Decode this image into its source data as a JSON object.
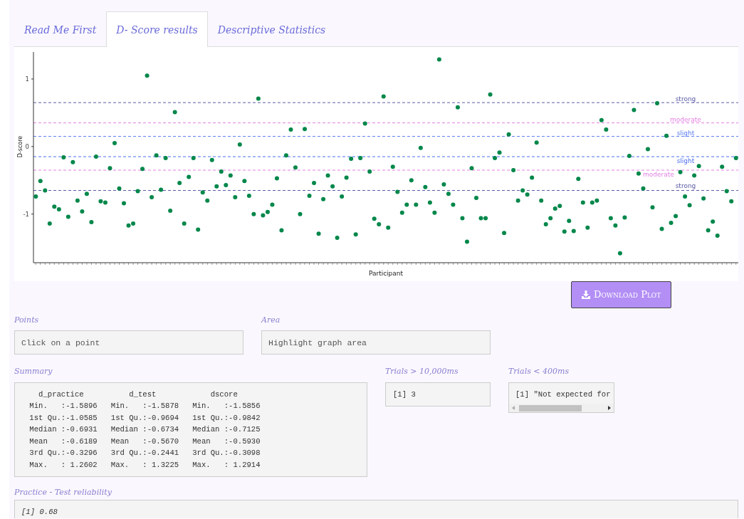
{
  "tabs": [
    {
      "label": "Read Me First",
      "selected": false
    },
    {
      "label": "D- Score results",
      "selected": true
    },
    {
      "label": "Descriptive Statistics",
      "selected": false
    }
  ],
  "plot": {
    "chart_data": {
      "type": "scatter",
      "xlabel": "Participant",
      "ylabel": "D-score",
      "ylim": [
        -1.72,
        1.4
      ],
      "yticks": [
        -1,
        0,
        1
      ],
      "categories": [
        null,
        null,
        null,
        null,
        null,
        null,
        null,
        null,
        null,
        null,
        null,
        null,
        null,
        null,
        null,
        null,
        null,
        null,
        null,
        null,
        null,
        null,
        null,
        null,
        null,
        null,
        null,
        null,
        null,
        null,
        null,
        null,
        null,
        null,
        null,
        null,
        null,
        null,
        null,
        null,
        null,
        null,
        null,
        null,
        null,
        null,
        null,
        null,
        null,
        null,
        null,
        null,
        null,
        null,
        null,
        null,
        null,
        null,
        null,
        null,
        null,
        null,
        null,
        null,
        null,
        null,
        null,
        null,
        null,
        null,
        null,
        null,
        null,
        null,
        null,
        null,
        null,
        null,
        null,
        null,
        null,
        null,
        null,
        null,
        null,
        null,
        null,
        null,
        null,
        null,
        null,
        null,
        null,
        null,
        null,
        null,
        null,
        null,
        null,
        null,
        null,
        null,
        null,
        null,
        null,
        null,
        null,
        null,
        null,
        null,
        null,
        null,
        null,
        null,
        null,
        null,
        null,
        null,
        null,
        null,
        null,
        null,
        null,
        null,
        null,
        null,
        null,
        null,
        null,
        null,
        null,
        null,
        null,
        null,
        null,
        null,
        null,
        null,
        null,
        null,
        null,
        null,
        null,
        null,
        null,
        null,
        null,
        null,
        null,
        null,
        null,
        null
      ],
      "series": [
        {
          "color": "#00874a",
          "values": [
            -0.74,
            -0.51,
            -0.65,
            -1.14,
            -0.89,
            -0.93,
            -0.16,
            -1.04,
            -0.23,
            -0.8,
            -0.96,
            -0.7,
            -1.12,
            -0.15,
            -0.81,
            -0.83,
            -0.32,
            0.05,
            -0.62,
            -0.84,
            -1.17,
            -1.14,
            -0.66,
            -0.33,
            1.05,
            -0.75,
            -0.13,
            -0.64,
            -0.17,
            -0.95,
            0.51,
            -0.54,
            -1.14,
            -0.45,
            -0.17,
            -1.23,
            -0.68,
            -0.8,
            -0.2,
            -0.59,
            -0.37,
            -0.57,
            -0.43,
            -0.75,
            0.03,
            -0.51,
            -0.73,
            -1.0,
            0.71,
            -1.02,
            -0.97,
            -0.86,
            -0.47,
            -1.24,
            -0.13,
            0.25,
            -0.31,
            -1.0,
            0.26,
            -0.73,
            -0.54,
            -1.29,
            -0.78,
            -0.43,
            -0.59,
            -1.35,
            -0.74,
            -0.46,
            -0.18,
            -1.3,
            -0.17,
            0.34,
            -0.37,
            -1.07,
            -1.15,
            0.74,
            -1.2,
            -0.3,
            -0.67,
            -0.98,
            -0.86,
            -0.5,
            -0.86,
            -0.02,
            -0.6,
            -0.83,
            -0.98,
            1.29,
            -0.56,
            -0.7,
            -0.86,
            0.58,
            -1.06,
            -1.41,
            -0.32,
            -0.76,
            -1.06,
            -1.06,
            0.77,
            -0.17,
            -0.09,
            -1.28,
            0.18,
            -0.35,
            -0.8,
            -0.65,
            -0.71,
            -0.46,
            0.06,
            -0.8,
            -1.15,
            -1.06,
            -0.92,
            -0.88,
            -1.26,
            -1.1,
            -1.25,
            -0.48,
            -0.83,
            -1.2,
            -0.83,
            -0.8,
            0.39,
            0.25,
            -1.06,
            -1.17,
            -1.58,
            -1.05,
            -0.14,
            0.54,
            -0.4,
            -0.62,
            -0.04,
            -0.9,
            0.64,
            -1.22,
            0.16,
            -1.13,
            -1.03,
            -0.38,
            -0.74,
            -0.87,
            -0.43,
            -0.29,
            -0.77,
            -1.24,
            -1.11,
            -1.32,
            -0.3,
            -0.66,
            -0.81,
            -0.17
          ]
        }
      ],
      "ref_lines": [
        {
          "axis": "y",
          "value": 0.65,
          "label": "strong",
          "color": "#5a5aa6"
        },
        {
          "axis": "y",
          "value": 0.35,
          "label": "moderate",
          "color": "#e27fe2"
        },
        {
          "axis": "y",
          "value": 0.15,
          "label": "slight",
          "color": "#5b7cf0"
        },
        {
          "axis": "y",
          "value": -0.15,
          "label": "slight",
          "color": "#4d6ff0"
        },
        {
          "axis": "y",
          "value": -0.35,
          "label": "moderate",
          "color": "#e27fe2"
        },
        {
          "axis": "y",
          "value": -0.65,
          "label": "strong",
          "color": "#5a5aa6"
        }
      ]
    }
  },
  "download_button": {
    "label": "Download Plot"
  },
  "points": {
    "label": "Points",
    "placeholder": "Click on a point"
  },
  "area": {
    "label": "Area",
    "placeholder": "Highlight graph area"
  },
  "summary": {
    "label": "Summary",
    "lines": [
      "   d_practice          d_test            dscore",
      " Min.   :-1.5896   Min.   :-1.5878   Min.   :-1.5856",
      " 1st Qu.:-1.0585   1st Qu.:-0.9694   1st Qu.:-0.9842",
      " Median :-0.6931   Median :-0.6734   Median :-0.7125",
      " Mean   :-0.6189   Mean   :-0.5670   Mean   :-0.5930",
      " 3rd Qu.:-0.3296   3rd Qu.:-0.2441   3rd Qu.:-0.3098",
      " Max.   : 1.2602   Max.   : 1.3225   Max.   : 1.2914"
    ]
  },
  "trials_over": {
    "label": "Trials > 10,000ms",
    "output": "[1] 3"
  },
  "trials_under": {
    "label": "Trials < 400ms",
    "output": "[1] \"Not expected for"
  },
  "reliability": {
    "label": "Practice - Test reliability",
    "output": "[1] 0.68"
  }
}
